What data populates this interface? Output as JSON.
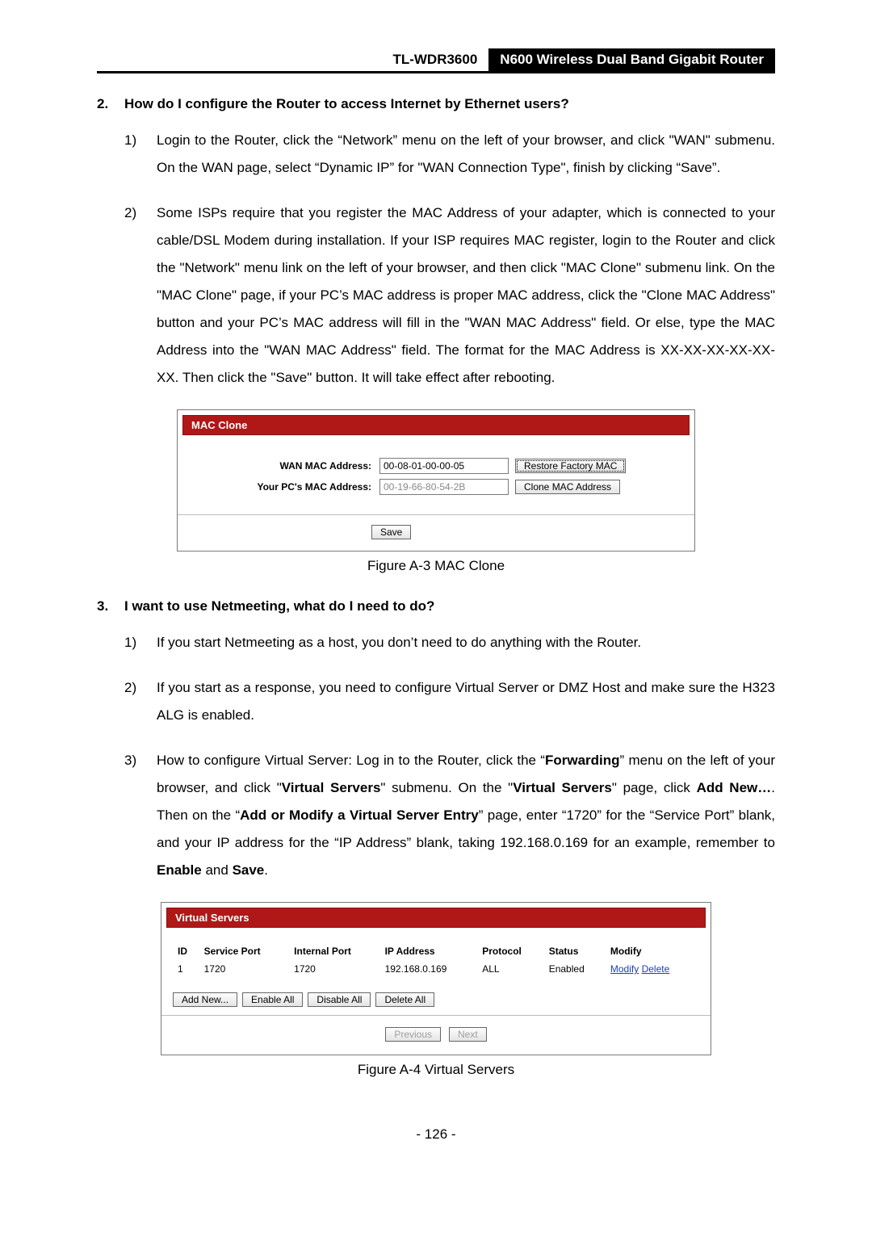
{
  "header": {
    "model": "TL-WDR3600",
    "product": "N600 Wireless Dual Band Gigabit Router"
  },
  "q2": {
    "num": "2.",
    "text": "How do I configure the Router to access Internet by Ethernet users?",
    "step1_num": "1)",
    "step1_txt": "Login to the Router, click the “Network” menu on the left of your browser, and click \"WAN\" submenu. On the WAN page, select “Dynamic IP” for \"WAN Connection Type\", finish by clicking “Save”.",
    "step2_num": "2)",
    "step2_txt": "Some ISPs require that you register the MAC Address of your adapter, which is connected to your cable/DSL Modem during installation. If your ISP requires MAC register, login to the Router and click the \"Network\" menu link on the left of your browser, and then click \"MAC Clone\" submenu link. On the \"MAC Clone\" page, if your PC’s MAC address is proper MAC address, click the \"Clone MAC Address\" button and your PC’s MAC address will fill in the \"WAN MAC Address\" field. Or else, type the MAC Address into the \"WAN MAC Address\" field. The format for the MAC Address is XX-XX-XX-XX-XX-XX. Then click the \"Save\" button. It will take effect after rebooting."
  },
  "mac": {
    "title": "MAC Clone",
    "wan_label": "WAN MAC Address:",
    "wan_val": "00-08-01-00-00-05",
    "restore_btn": "Restore Factory MAC",
    "pc_label": "Your PC's MAC Address:",
    "pc_val": "00-19-66-80-54-2B",
    "clone_btn": "Clone MAC Address",
    "save_btn": "Save",
    "caption": "Figure A-3 MAC Clone"
  },
  "q3": {
    "num": "3.",
    "text": "I want to use Netmeeting, what do I need to do?",
    "s1n": "1)",
    "s1t": "If you start Netmeeting as a host, you don’t need to do anything with the Router.",
    "s2n": "2)",
    "s2t": "If you start as a response, you need to configure Virtual Server or DMZ Host and make sure the H323 ALG is enabled.",
    "s3n": "3)"
  },
  "q3_s3": {
    "a": "How to configure Virtual Server: Log in to the Router, click the “",
    "b": "Forwarding",
    "c": "” menu on the left of your browser, and click \"",
    "d": "Virtual Servers",
    "e": "\" submenu. On the \"",
    "f": "Virtual Servers",
    "g": "\" page, click ",
    "h": "Add New…",
    "i": ". Then on the “",
    "j": "Add or Modify a Virtual Server Entry",
    "k": "” page, enter “1720” for the “Service Port” blank, and your IP address for the “IP Address” blank, taking 192.168.0.169 for an example, remember to ",
    "l": "Enable",
    "m": " and ",
    "n": "Save",
    "o": "."
  },
  "vs": {
    "title": "Virtual Servers",
    "h_id": "ID",
    "h_sp": "Service Port",
    "h_ip2": "Internal Port",
    "h_ip": "IP Address",
    "h_pr": "Protocol",
    "h_st": "Status",
    "h_mo": "Modify",
    "r_id": "1",
    "r_sp": "1720",
    "r_ip2": "1720",
    "r_ip": "192.168.0.169",
    "r_pr": "ALL",
    "r_st": "Enabled",
    "mod_link": "Modify",
    "del_link": "Delete",
    "add_btn": "Add New...",
    "ena_btn": "Enable All",
    "dis_btn": "Disable All",
    "del_btn": "Delete All",
    "prev_btn": "Previous",
    "next_btn": "Next",
    "caption": "Figure A-4 Virtual Servers"
  },
  "pagenum": "- 126 -"
}
